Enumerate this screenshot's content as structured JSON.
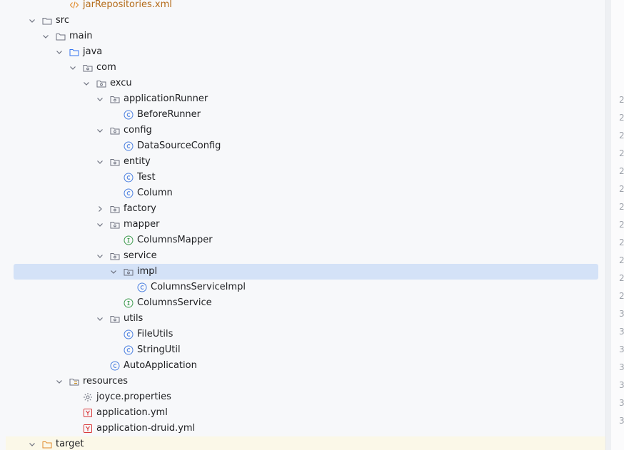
{
  "project_tree": {
    "nodes": [
      {
        "label": "jarRepositories.xml",
        "icon": "xml-file-icon",
        "expand": "none",
        "depth": 3
      },
      {
        "label": "src",
        "icon": "folder-icon",
        "expand": "expanded",
        "depth": 1
      },
      {
        "label": "main",
        "icon": "folder-icon",
        "expand": "expanded",
        "depth": 2
      },
      {
        "label": "java",
        "icon": "source-root-icon",
        "expand": "expanded",
        "depth": 3
      },
      {
        "label": "com",
        "icon": "package-icon",
        "expand": "expanded",
        "depth": 4
      },
      {
        "label": "excu",
        "icon": "package-icon",
        "expand": "expanded",
        "depth": 5
      },
      {
        "label": "applicationRunner",
        "icon": "package-icon",
        "expand": "expanded",
        "depth": 6
      },
      {
        "label": "BeforeRunner",
        "icon": "class-icon",
        "expand": "none",
        "depth": 7
      },
      {
        "label": "config",
        "icon": "package-icon",
        "expand": "expanded",
        "depth": 6
      },
      {
        "label": "DataSourceConfig",
        "icon": "class-icon",
        "expand": "none",
        "depth": 7
      },
      {
        "label": "entity",
        "icon": "package-icon",
        "expand": "expanded",
        "depth": 6
      },
      {
        "label": "Test",
        "icon": "class-icon",
        "expand": "none",
        "depth": 7
      },
      {
        "label": "Column",
        "icon": "class-icon",
        "expand": "none",
        "depth": 7
      },
      {
        "label": "factory",
        "icon": "package-icon",
        "expand": "collapsed",
        "depth": 6
      },
      {
        "label": "mapper",
        "icon": "package-icon",
        "expand": "expanded",
        "depth": 6
      },
      {
        "label": "ColumnsMapper",
        "icon": "interface-icon",
        "expand": "none",
        "depth": 7
      },
      {
        "label": "service",
        "icon": "package-icon",
        "expand": "expanded",
        "depth": 6
      },
      {
        "label": "impl",
        "icon": "package-icon",
        "expand": "expanded",
        "depth": 7,
        "selected": true
      },
      {
        "label": "ColumnsServiceImpl",
        "icon": "class-icon",
        "expand": "none",
        "depth": 8
      },
      {
        "label": "ColumnsService",
        "icon": "interface-icon",
        "expand": "none",
        "depth": 7
      },
      {
        "label": "utils",
        "icon": "package-icon",
        "expand": "expanded",
        "depth": 6
      },
      {
        "label": "FileUtils",
        "icon": "class-icon",
        "expand": "none",
        "depth": 7
      },
      {
        "label": "StringUtil",
        "icon": "class-icon",
        "expand": "none",
        "depth": 7
      },
      {
        "label": "AutoApplication",
        "icon": "class-icon",
        "expand": "none",
        "depth": 6
      },
      {
        "label": "resources",
        "icon": "resources-folder-icon",
        "expand": "expanded",
        "depth": 3
      },
      {
        "label": "joyce.properties",
        "icon": "properties-file-icon",
        "expand": "none",
        "depth": 4
      },
      {
        "label": "application.yml",
        "icon": "yaml-file-icon",
        "expand": "none",
        "depth": 4
      },
      {
        "label": "application-druid.yml",
        "icon": "yaml-file-icon",
        "expand": "none",
        "depth": 4
      },
      {
        "label": "target",
        "icon": "excluded-folder-icon",
        "expand": "expanded",
        "depth": 1,
        "highlight": "yellow"
      }
    ]
  },
  "editor_gutter": {
    "line_numbers": [
      "2",
      "2",
      "2",
      "2",
      "2",
      "2",
      "2",
      "2",
      "2",
      "2",
      "2",
      "2",
      "3",
      "3",
      "3",
      "3",
      "3",
      "3",
      "3"
    ]
  },
  "colors": {
    "selection": "#d4e2f7",
    "class_icon": "#4a7fe0",
    "interface_icon": "#3e9b4e",
    "yaml_icon": "#d9383a",
    "xml_text": "#b46b1a"
  }
}
